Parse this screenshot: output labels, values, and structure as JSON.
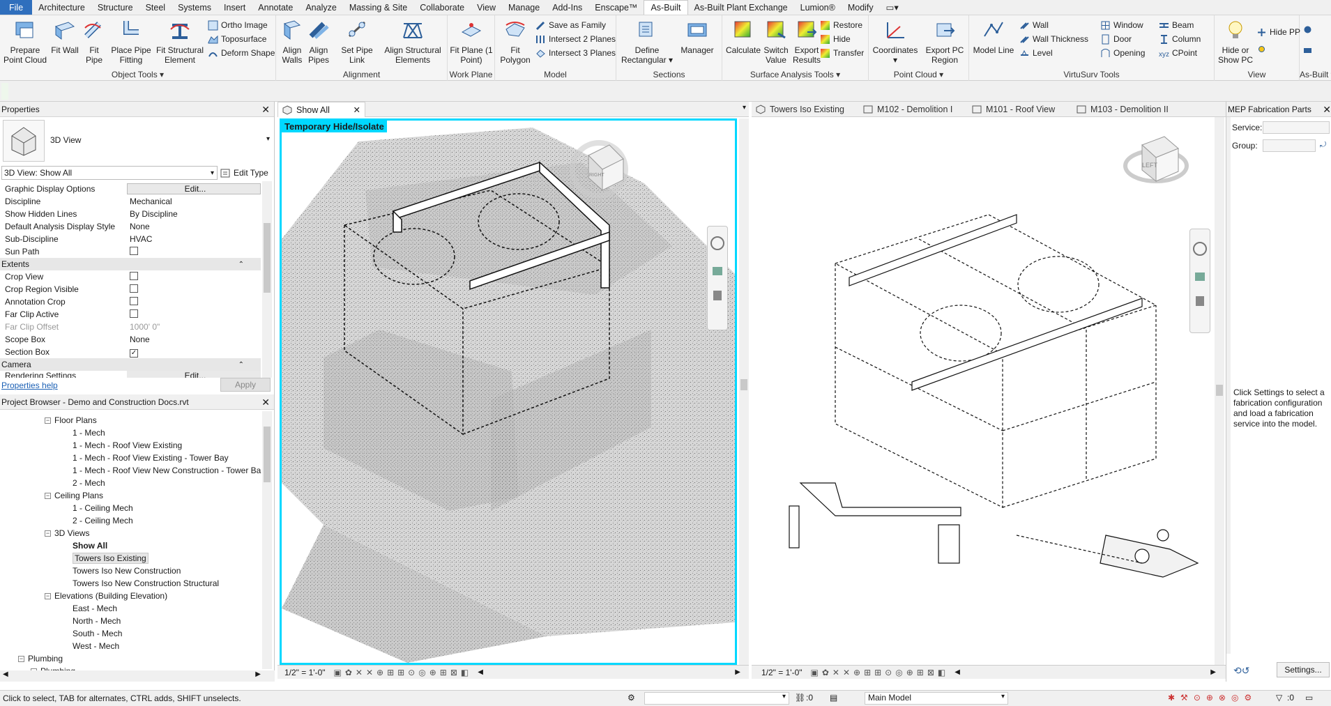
{
  "menu": [
    "File",
    "Architecture",
    "Structure",
    "Steel",
    "Systems",
    "Insert",
    "Annotate",
    "Analyze",
    "Massing & Site",
    "Collaborate",
    "View",
    "Manage",
    "Add-Ins",
    "Enscape™",
    "As-Built",
    "As-Built Plant Exchange",
    "Lumion®",
    "Modify"
  ],
  "ribbon": {
    "object_tools": {
      "label": "Object Tools",
      "prepare": "Prepare Point Cloud",
      "fitwall": "Fit Wall",
      "fitpipe": "Fit Pipe",
      "place": "Place Pipe Fitting",
      "fitstruct": "Fit Structural Element",
      "ortho": "Ortho Image",
      "topo": "Toposurface",
      "deform": "Deform Shape"
    },
    "alignment": {
      "label": "Alignment",
      "walls": "Align Walls",
      "pipes": "Align Pipes",
      "setlink": "Set Pipe Link",
      "structel": "Align Structural Elements"
    },
    "work_plane": {
      "label": "Work Plane",
      "fitplane": "Fit Plane (1 Point)"
    },
    "model": {
      "label": "Model",
      "fitpoly": "Fit Polygon",
      "save": "Save as Family",
      "int2": "Intersect 2 Planes",
      "int3": "Intersect 3 Planes"
    },
    "sections": {
      "label": "Sections",
      "define": "Define Rectangular",
      "manager": "Manager"
    },
    "surface": {
      "label": "Surface Analysis Tools",
      "calc": "Calculate",
      "switch": "Switch Value",
      "export": "Export Results",
      "restore": "Restore",
      "hide": "Hide",
      "transfer": "Transfer"
    },
    "pointcloud": {
      "label": "Point Cloud",
      "coords": "Coordinates",
      "exportpc": "Export PC Region"
    },
    "virtusurv": {
      "label": "VirtuSurv Tools",
      "modelline": "Model Line",
      "wall": "Wall",
      "wallthick": "Wall Thickness",
      "level": "Level",
      "window": "Window",
      "door": "Door",
      "opening": "Opening",
      "beam": "Beam",
      "column": "Column",
      "cpoint": "CPoint"
    },
    "view": {
      "label": "View",
      "hideor": "Hide or Show PC",
      "hidepp": "Hide PP"
    },
    "asbuilt": {
      "label": "As-Built"
    }
  },
  "properties": {
    "title": "Properties",
    "type": "3D View",
    "selector": "3D View: Show All",
    "edit_type": "Edit Type",
    "rows": [
      {
        "k": "Graphic Display Options",
        "v": "Edit..."
      },
      {
        "k": "Discipline",
        "v": "Mechanical"
      },
      {
        "k": "Show Hidden Lines",
        "v": "By Discipline"
      },
      {
        "k": "Default Analysis Display Style",
        "v": "None"
      },
      {
        "k": "Sub-Discipline",
        "v": "HVAC"
      },
      {
        "k": "Sun Path",
        "v": ""
      }
    ],
    "extents": "Extents",
    "rows2": [
      {
        "k": "Crop View",
        "v": ""
      },
      {
        "k": "Crop Region Visible",
        "v": ""
      },
      {
        "k": "Annotation Crop",
        "v": ""
      },
      {
        "k": "Far Clip Active",
        "v": ""
      },
      {
        "k": "Far Clip Offset",
        "v": "1000'  0\""
      },
      {
        "k": "Scope Box",
        "v": "None"
      },
      {
        "k": "Section Box",
        "v": ""
      }
    ],
    "camera": "Camera",
    "rendering": "Rendering Settings",
    "edit": "Edit...",
    "help": "Properties help",
    "apply": "Apply"
  },
  "browser": {
    "title": "Project Browser - Demo and Construction Docs.rvt",
    "nodes": [
      {
        "t": "Floor Plans",
        "lvl": 1,
        "tog": "−"
      },
      {
        "t": "1 - Mech",
        "lvl": 2
      },
      {
        "t": "1 - Mech - Roof View Existing",
        "lvl": 2
      },
      {
        "t": "1 - Mech - Roof View Existing - Tower Bay",
        "lvl": 2
      },
      {
        "t": "1 - Mech - Roof View New Construction - Tower Ba",
        "lvl": 2
      },
      {
        "t": "2 - Mech",
        "lvl": 2
      },
      {
        "t": "Ceiling Plans",
        "lvl": 1,
        "tog": "−"
      },
      {
        "t": "1 - Ceiling Mech",
        "lvl": 2
      },
      {
        "t": "2 - Ceiling Mech",
        "lvl": 2
      },
      {
        "t": "3D Views",
        "lvl": 1,
        "tog": "−"
      },
      {
        "t": "Show All",
        "lvl": 2,
        "bold": true
      },
      {
        "t": "Towers Iso Existing",
        "lvl": 2,
        "sel": true
      },
      {
        "t": "Towers Iso New Construction",
        "lvl": 2
      },
      {
        "t": "Towers Iso New Construction Structural",
        "lvl": 2
      },
      {
        "t": "Elevations (Building Elevation)",
        "lvl": 1,
        "tog": "−"
      },
      {
        "t": "East - Mech",
        "lvl": 2
      },
      {
        "t": "North - Mech",
        "lvl": 2
      },
      {
        "t": "South - Mech",
        "lvl": 2
      },
      {
        "t": "West - Mech",
        "lvl": 2
      },
      {
        "t": "Plumbing",
        "lvl": 0,
        "tog": "−"
      },
      {
        "t": "Plumbing",
        "lvl": 0.6,
        "tog": "−"
      }
    ]
  },
  "viewL": {
    "tab": "Show All",
    "banner": "Temporary Hide/Isolate",
    "scale": "1/2\" = 1'-0\""
  },
  "viewR": {
    "tabs": [
      "Towers Iso Existing",
      "M102 - Demolition I",
      "M101 - Roof View",
      "M103 - Demolition II"
    ],
    "scale": "1/2\" = 1'-0\"",
    "cube_left": "LEFT"
  },
  "cube_l": {
    "right": "RIGHT"
  },
  "mep": {
    "title": "MEP Fabrication Parts",
    "service": "Service:",
    "group": "Group:",
    "msg": "Click Settings to select a fabrication configuration and load a fabrication service into the model.",
    "settings": "Settings..."
  },
  "status": {
    "text": "Click to select, TAB for alternates, CTRL adds, SHIFT unselects.",
    "zero": ":0",
    "model": "Main Model",
    "filter": ":0"
  },
  "colors": {
    "accent": "#2f6fbd",
    "highlight": "#00d8ff"
  }
}
